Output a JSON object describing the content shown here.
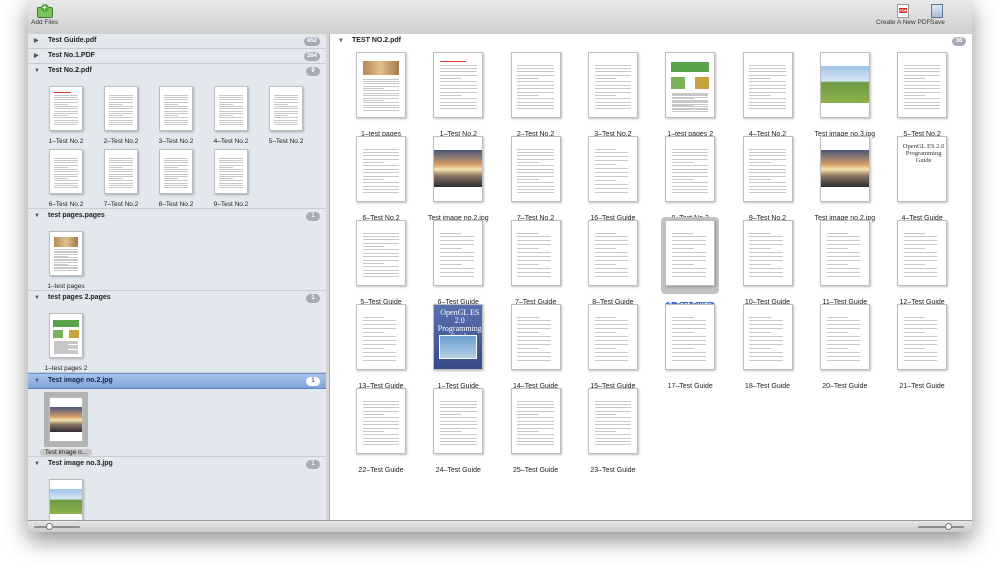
{
  "toolbar": {
    "add_files": "Add Files",
    "create_pdf": "Create A New PDF",
    "save": "Save",
    "pdf_badge": "PDF"
  },
  "sidebar": {
    "groups": [
      {
        "title": "Test Guide.pdf",
        "count": "452",
        "expanded": false,
        "items": []
      },
      {
        "title": "Test No.1.PDF",
        "count": "364",
        "expanded": false,
        "items": []
      },
      {
        "title": "Test No.2.pdf",
        "count": "9",
        "expanded": true,
        "items": [
          {
            "label": "1–Test No.2",
            "kind": "doc-red"
          },
          {
            "label": "2–Test No.2",
            "kind": "doc"
          },
          {
            "label": "3–Test No.2",
            "kind": "doc"
          },
          {
            "label": "4–Test No.2",
            "kind": "doc"
          },
          {
            "label": "5–Test No.2",
            "kind": "doc"
          },
          {
            "label": "6–Test No.2",
            "kind": "doc"
          },
          {
            "label": "7–Test No.2",
            "kind": "doc"
          },
          {
            "label": "8–Test No.2",
            "kind": "doc"
          },
          {
            "label": "9–Test No.2",
            "kind": "doc"
          }
        ]
      },
      {
        "title": "test pages.pages",
        "count": "1",
        "expanded": true,
        "items": [
          {
            "label": "1–test pages",
            "kind": "brochure"
          }
        ]
      },
      {
        "title": "test pages 2.pages",
        "count": "1",
        "expanded": true,
        "items": [
          {
            "label": "1–test pages 2",
            "kind": "green"
          }
        ]
      },
      {
        "title": "Test image no.2.jpg",
        "count": "1",
        "expanded": true,
        "selected": true,
        "items": [
          {
            "label": "Test image n...",
            "kind": "photo",
            "selected": true
          }
        ]
      },
      {
        "title": "Test image no.3.jpg",
        "count": "1",
        "expanded": true,
        "items": [
          {
            "label": "Test image n...",
            "kind": "field"
          }
        ]
      }
    ]
  },
  "main": {
    "title": "TEST NO.2.pdf",
    "count": "36",
    "items": [
      {
        "label": "1–test pages",
        "kind": "brochure"
      },
      {
        "label": "1–Test No.2",
        "kind": "doc-red"
      },
      {
        "label": "2–Test No.2",
        "kind": "doc"
      },
      {
        "label": "3–Test No.2",
        "kind": "doc"
      },
      {
        "label": "1–test pages 2",
        "kind": "green"
      },
      {
        "label": "4–Test No.2",
        "kind": "doc"
      },
      {
        "label": "Test image no.3.jpg",
        "kind": "field"
      },
      {
        "label": "5–Test No.2",
        "kind": "doc"
      },
      {
        "label": "6–Test No.2",
        "kind": "doc"
      },
      {
        "label": "Test image no.2.jpg",
        "kind": "photo"
      },
      {
        "label": "7–Test No.2",
        "kind": "doc"
      },
      {
        "label": "16–Test Guide",
        "kind": "toc"
      },
      {
        "label": "8–Test No.2",
        "kind": "doc"
      },
      {
        "label": "9–Test No.2",
        "kind": "doc"
      },
      {
        "label": "Test image no.2.jpg",
        "kind": "photo"
      },
      {
        "label": "4–Test Guide",
        "kind": "textcover",
        "cover_text": "OpenGL ES 2.0 Programming Guide"
      },
      {
        "label": "5–Test Guide",
        "kind": "doc"
      },
      {
        "label": "6–Test Guide",
        "kind": "toc"
      },
      {
        "label": "7–Test Guide",
        "kind": "toc"
      },
      {
        "label": "8–Test Guide",
        "kind": "toc"
      },
      {
        "label": "9–Test Guide",
        "kind": "toc",
        "selected": true
      },
      {
        "label": "10–Test Guide",
        "kind": "toc"
      },
      {
        "label": "11–Test Guide",
        "kind": "toc"
      },
      {
        "label": "12–Test Guide",
        "kind": "toc"
      },
      {
        "label": "13–Test Guide",
        "kind": "toc"
      },
      {
        "label": "1–Test Guide",
        "kind": "cover",
        "cover_text": "OpenGL ES 2.0 Programming Guide"
      },
      {
        "label": "14–Test Guide",
        "kind": "toc"
      },
      {
        "label": "15–Test Guide",
        "kind": "toc"
      },
      {
        "label": "17–Test Guide",
        "kind": "toc"
      },
      {
        "label": "18–Test Guide",
        "kind": "toc"
      },
      {
        "label": "20–Test Guide",
        "kind": "toc"
      },
      {
        "label": "21–Test Guide",
        "kind": "toc"
      },
      {
        "label": "22–Test Guide",
        "kind": "doc"
      },
      {
        "label": "24–Test Guide",
        "kind": "doc"
      },
      {
        "label": "25–Test Guide",
        "kind": "doc"
      },
      {
        "label": "23–Test Guide",
        "kind": "doc"
      }
    ]
  },
  "sliders": {
    "sidebar_zoom": 0.3,
    "main_zoom": 0.7
  }
}
